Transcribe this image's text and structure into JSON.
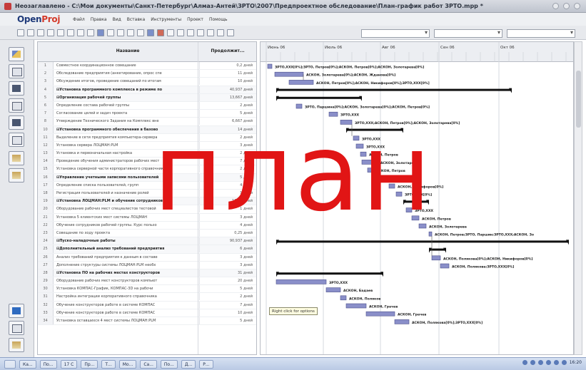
{
  "window": {
    "title": "Неозаглавлено - C:\\Мои документы\\Санкт-Петербург\\Алмаз-Антей\\ЗРТО\\2007\\Предпроектное обследование\\План-график работ ЗРТО.mpp *"
  },
  "app": {
    "logo_main": "Open",
    "logo_accent": "Proj"
  },
  "menu": [
    "Файл",
    "Правка",
    "Вид",
    "Вставка",
    "Инструменты",
    "Проект",
    "Помощь"
  ],
  "grid": {
    "columns": {
      "name": "Название",
      "duration": "Продолжит..."
    },
    "rows": [
      {
        "num": "1",
        "name": "Совместное координационное совещание",
        "dur": "0,2 дней",
        "summary": false
      },
      {
        "num": "2",
        "name": "Обследование предприятия (анкетирование, опрос спе",
        "dur": "11 дней",
        "summary": false
      },
      {
        "num": "3",
        "name": "Обсуждение итогов, проведение совещаний по итогам",
        "dur": "10 дней",
        "summary": false
      },
      {
        "num": "4",
        "name": "⊟Установка программного комплекса в режиме по",
        "dur": "40,937 дней",
        "summary": true
      },
      {
        "num": "5",
        "name": "⊟Организация рабочей группы",
        "dur": "13,667 дней",
        "summary": true
      },
      {
        "num": "6",
        "name": "Определение состава рабочей группы",
        "dur": "2 дней",
        "summary": false
      },
      {
        "num": "7",
        "name": "Согласование целей и задач проекта",
        "dur": "5 дней",
        "summary": false
      },
      {
        "num": "8",
        "name": "Утверждение Технического Задания на Комплекс вне",
        "dur": "6,667 дней",
        "summary": false
      },
      {
        "num": "10",
        "name": "⊟Установка программного обеспечения в базово",
        "dur": "14 дней",
        "summary": true
      },
      {
        "num": "11",
        "name": "Выделение в сети предприятия компьютера-сервера",
        "dur": "2 дней",
        "summary": false
      },
      {
        "num": "12",
        "name": "Установка сервера ЛОЦМАН:PLM",
        "dur": "3 дней",
        "summary": false
      },
      {
        "num": "13",
        "name": "Установка и первоначальная настройка",
        "dur": "2 дней",
        "summary": false
      },
      {
        "num": "14",
        "name": "Проведение обучения администраторов рабочих мест",
        "dur": "7 дней",
        "summary": false
      },
      {
        "num": "15",
        "name": "Установка серверной части корпоративного справочника",
        "dur": "2 дней",
        "summary": false
      },
      {
        "num": "16",
        "name": "⊟Управление учетными записями пользователей",
        "dur": "5 дней",
        "summary": true
      },
      {
        "num": "17",
        "name": "Определение списка пользователей, групп",
        "dur": "4 дней",
        "summary": false
      },
      {
        "num": "18",
        "name": "Регистрация пользователей и назначение ролей",
        "dur": "1 дней",
        "summary": false
      },
      {
        "num": "19",
        "name": "⊟Установка ЛОЦМАН:PLM и обучение сотрудников",
        "dur": "13,25 дней",
        "summary": true
      },
      {
        "num": "20",
        "name": "Оборудование рабочих мест специалистов тестовой",
        "dur": "1 дней",
        "summary": false
      },
      {
        "num": "21",
        "name": "Установка 5 клиентских мест системы ЛОЦМАН",
        "dur": "3 дней",
        "summary": false
      },
      {
        "num": "22",
        "name": "Обучение сотрудников рабочей группы. Курс пользо",
        "dur": "4 дней",
        "summary": false
      },
      {
        "num": "23",
        "name": "Совещание по ходу проекта",
        "dur": "0,25 дней",
        "summary": false
      },
      {
        "num": "24",
        "name": "⊟Пуско-наладочные работы",
        "dur": "90,937 дней",
        "summary": true
      },
      {
        "num": "25",
        "name": "⊟Дополнительный анализ требований предприятия",
        "dur": "6 дней",
        "summary": true
      },
      {
        "num": "26",
        "name": "Анализ требований предприятия к данным в составе",
        "dur": "3 дней",
        "summary": false
      },
      {
        "num": "27",
        "name": "Дополнение структуры системы ЛОЦМАН:PLM необх",
        "dur": "3 дней",
        "summary": false
      },
      {
        "num": "28",
        "name": "⊟Установка ПО на рабочих местах конструкторов",
        "dur": "31 дней",
        "summary": true
      },
      {
        "num": "29",
        "name": "Оборудование рабочих мест конструкторов компьют",
        "dur": "20 дней",
        "summary": false
      },
      {
        "num": "30",
        "name": "Установка КОМПАС-График, КОМПАС-3D на рабочи",
        "dur": "5 дней",
        "summary": false
      },
      {
        "num": "31",
        "name": "Настройка интеграции корпоративного справочника",
        "dur": "2 дней",
        "summary": false
      },
      {
        "num": "32",
        "name": "Обучение конструкторов работе в системе КОМПАС",
        "dur": "7 дней",
        "summary": false
      },
      {
        "num": "33",
        "name": "Обучение конструкторов работе в системе КОМПАС",
        "dur": "10 дней",
        "summary": false
      },
      {
        "num": "34",
        "name": "Установка оставшихся 4 мест системы ЛОЦМАН:PLM",
        "dur": "5 дней",
        "summary": false
      }
    ]
  },
  "gantt": {
    "months": [
      "Июнь 06",
      "Июль 06",
      "Авг 06",
      "Сен 06",
      "Окт 06"
    ],
    "labels": [
      "ЗРТО,XXX[0%];ЗРТО, Петров[0%];АСКОН, Петров[0%];АСКОН, Золотарева[0%]",
      "АСКОН, Золотарева[0%];АСКОН, Жданова[0%]",
      "АСКОН, Петров[0%];АСКОН, Никифоров[0%];ЗРТО,XXX[0%]",
      "ЗРТО, Паршина[0%];АСКОН, Золотарева[0%];АСКОН, Петров[0%]",
      "ЗРТО,XXX",
      "ЗРТО,XXX;АСКОН, Петров[0%];АСКОН, Золотарева[0%]",
      "ЗРТО,XXX",
      "ЗРТО,XXX",
      "АСКОН, Петров",
      "АСКОН, Золотарева",
      "АСКОН, Петров",
      "АСКОН, Никифоров[0%]",
      "ЗРТО,XXX[0%]",
      "ЗРТО,XXX",
      "АСКОН, Петров",
      "АСКОН, Золотарева",
      "АСКОН, Петров;ЗРТО, Паршин;ЗРТО,XXX;АСКОН, Зо",
      "АСКОН, Полякова[0%];АСКОН, Никифоров[0%]",
      "АСКОН, Полякова;ЗРТО,XXX[0%]",
      "ЗРТО,XXX",
      "АСКОН, Бадаев",
      "АСКОН, Поляков",
      "АСКОН, Грачев",
      "АСКОН, Грачев",
      "АСКОН, Полякова[0%];ЗРТО,XXX[0%]"
    ],
    "tooltip": "Right click for options"
  },
  "taskbar": {
    "items": [
      "Ка...",
      "По...",
      "17 С",
      "Пр...",
      "Т...",
      "Мо...",
      "Са...",
      "По...",
      "Д...",
      "Р..."
    ],
    "clock": "16:20"
  },
  "overlay_word": "план"
}
